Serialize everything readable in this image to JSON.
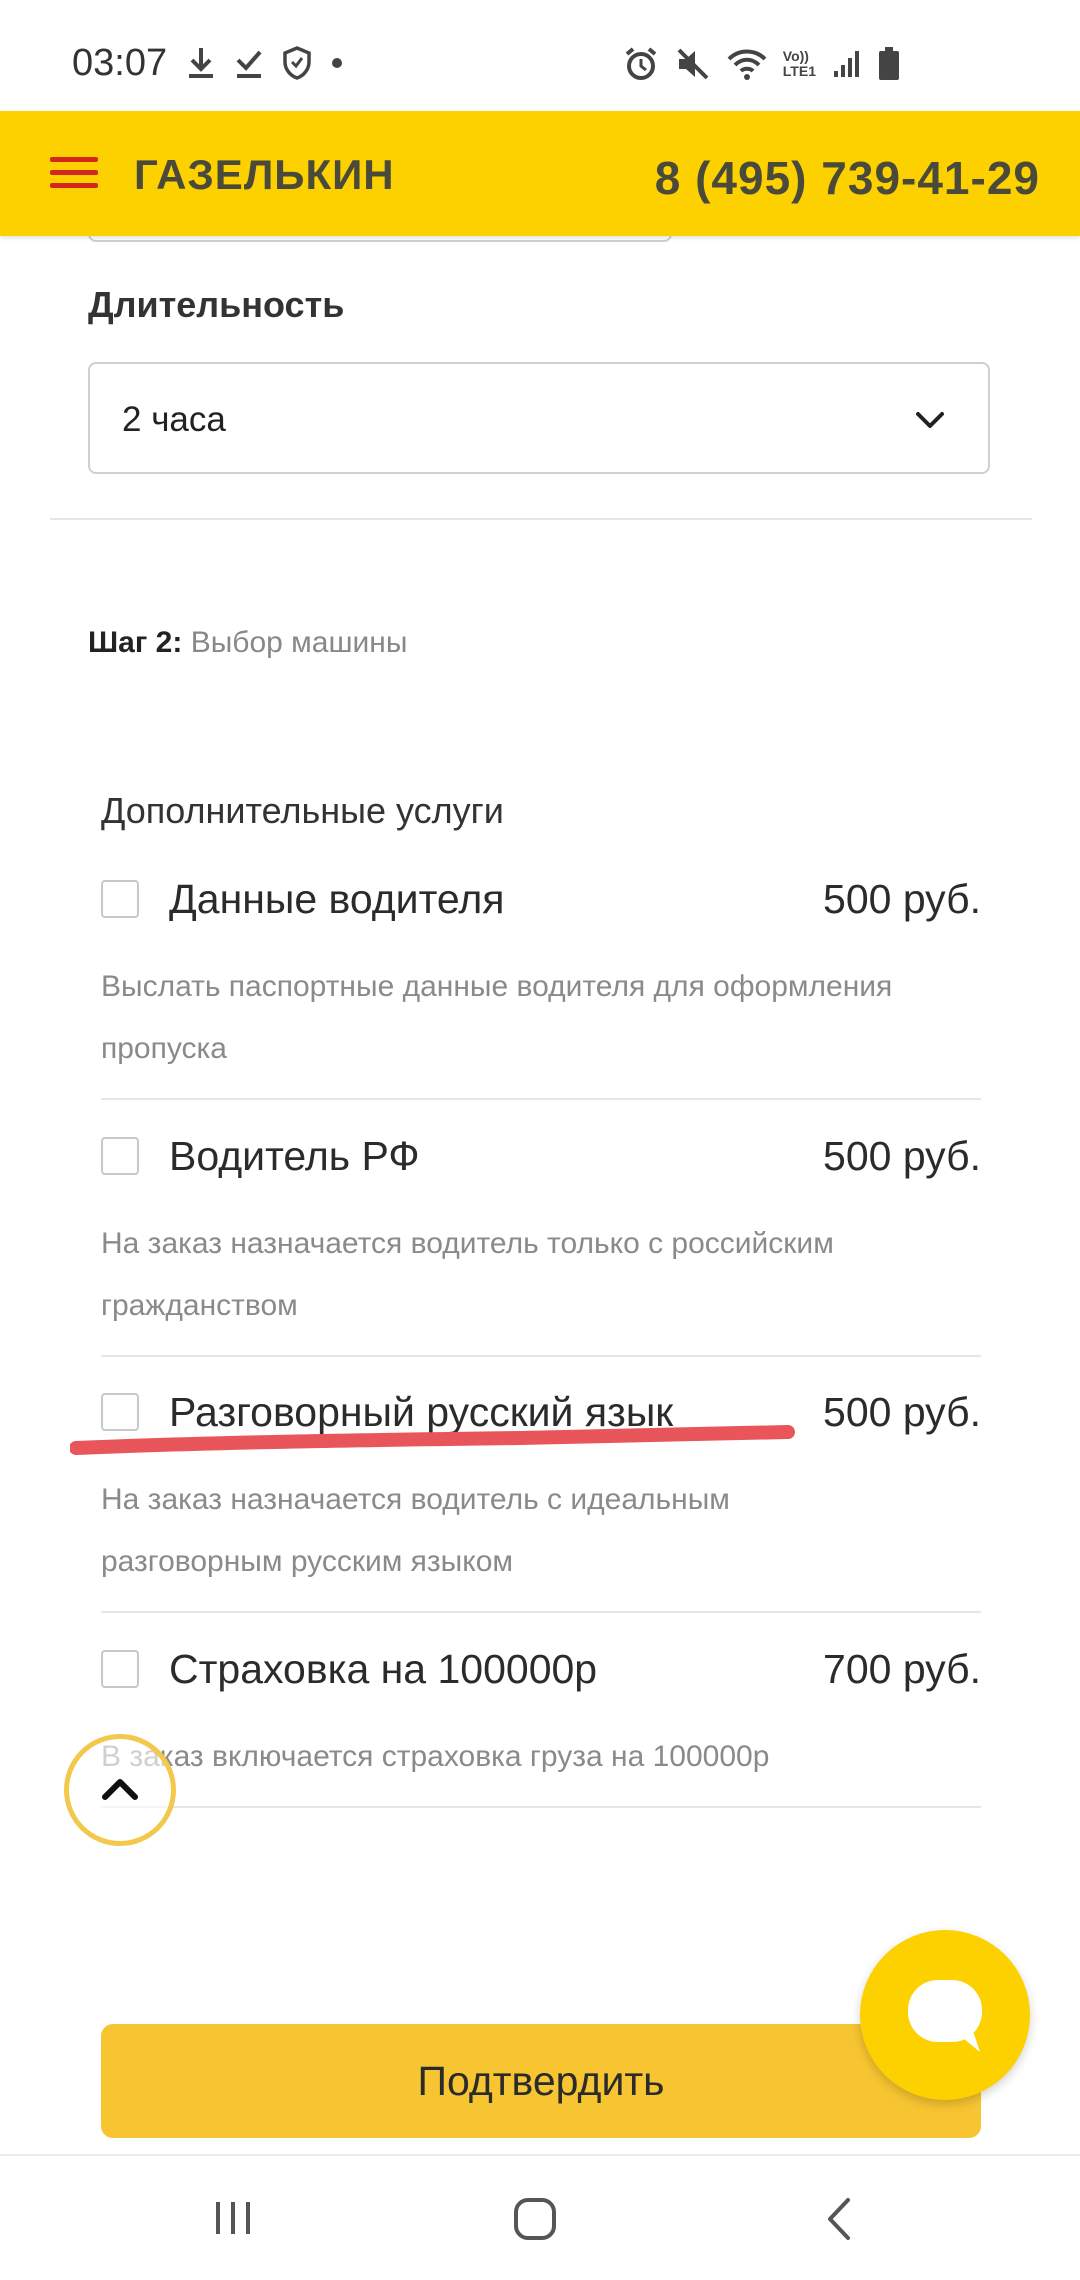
{
  "status_bar": {
    "time": "03:07",
    "icons_left": [
      "download-icon",
      "check-icon",
      "shield-icon",
      "dot-icon"
    ],
    "icons_right": [
      "alarm-icon",
      "mute-icon",
      "wifi-icon",
      "volte-icon",
      "signal-icon",
      "battery-icon"
    ],
    "volte_label_top": "Vo))",
    "volte_label_bottom": "LTE1"
  },
  "header": {
    "brand": "ГАЗЕЛЬКИН",
    "phone": "8 (495) 739-41-29",
    "accent_color": "#fdd000",
    "burger_color": "#d5261d"
  },
  "duration": {
    "label": "Длительность",
    "selected": "2 часа"
  },
  "step": {
    "label": "Шаг 2:",
    "text": "Выбор машины"
  },
  "extras": {
    "title": "Дополнительные услуги",
    "items": [
      {
        "name": "Данные водителя",
        "price": "500 руб.",
        "desc": "Выслать паспортные данные водителя для оформления пропуска",
        "checked": false
      },
      {
        "name": "Водитель РФ",
        "price": "500 руб.",
        "desc": "На заказ назначается водитель только с российским гражданством",
        "checked": false
      },
      {
        "name": "Разговорный русский язык",
        "price": "500 руб.",
        "desc": "На заказ назначается водитель с идеальным разговорным русским языком",
        "checked": false
      },
      {
        "name": "Страховка на 100000р",
        "price": "700 руб.",
        "desc": "В заказ включается страховка груза на 100000р",
        "checked": false
      }
    ]
  },
  "confirm_button": "Подтвердить",
  "nav": {
    "buttons": [
      "recent-apps-icon",
      "home-icon",
      "back-icon"
    ]
  }
}
